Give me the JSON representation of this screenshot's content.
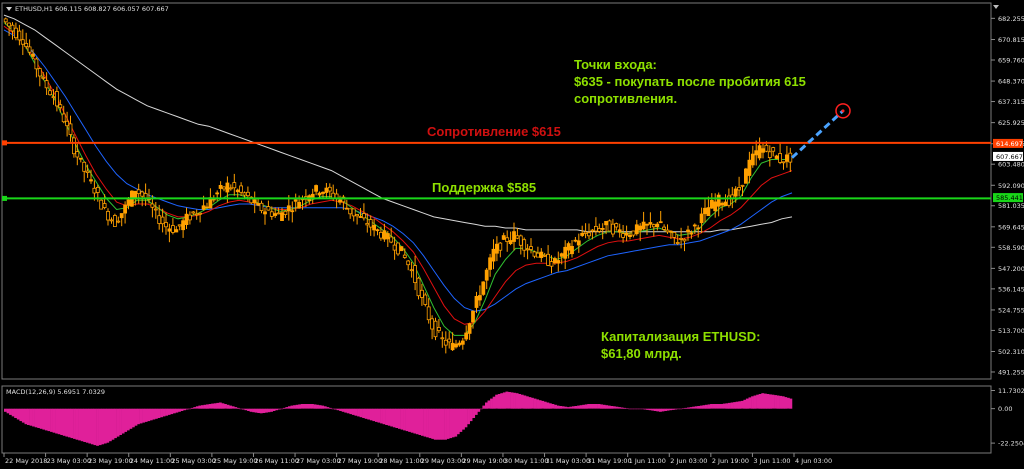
{
  "header": {
    "symbol_info": "ETHUSD,H1  606.115 608.827 606.057 607.667",
    "macd_info": "MACD(12,26,9) 5.6951 7.0329"
  },
  "colors": {
    "background": "#000000",
    "candle_up": "#ffa000",
    "candle_down": "#ffa000",
    "resistance": "#ff4000",
    "support": "#19d619",
    "ma_red": "#e01010",
    "ma_green": "#30c030",
    "ma_blue": "#1e64ff",
    "ma_white": "#d8d8d8",
    "macd": "#e0209a",
    "annotation_green": "#8ee000",
    "annotation_red": "#d01010",
    "arrow": "#4aa3ff",
    "target_circle": "#ff2020",
    "grid_text": "#e0e0e0"
  },
  "annotations": {
    "entry_line1": "Точки входа:",
    "entry_line2": "$635 - покупать после пробития 615",
    "entry_line3": "сопротивления.",
    "resistance_label": "Сопротивление $615",
    "support_label": "Поддержка $585",
    "cap_line1": "Капитализация ETHUSD:",
    "cap_line2": "$61,80 млрд."
  },
  "chart_data": [
    {
      "type": "candlestick",
      "symbol": "ETHUSD",
      "timeframe": "H1",
      "ylim": [
        488,
        690
      ],
      "yticks": [
        "682.255",
        "670.815",
        "659.760",
        "648.370",
        "637.315",
        "625.925",
        "614.535",
        "603.480",
        "592.090",
        "581.035",
        "569.645",
        "558.590",
        "547.200",
        "536.145",
        "524.755",
        "513.700",
        "502.310",
        "491.255"
      ],
      "current_price_label": "607.667",
      "resistance_label_value": "614.697",
      "support_label_value": "585.441",
      "resistance": 615,
      "support": 585,
      "target": 635,
      "xticks": [
        "22 May 2018",
        "23 May 03:00",
        "23 May 19:00",
        "24 May 11:00",
        "25 May 03:00",
        "25 May 19:00",
        "26 May 11:00",
        "27 May 03:00",
        "27 May 19:00",
        "28 May 11:00",
        "29 May 03:00",
        "29 May 19:00",
        "30 May 11:00",
        "31 May 03:00",
        "31 May 19:00",
        "1 Jun 11:00",
        "2 Jun 03:00",
        "2 Jun 19:00",
        "3 Jun 11:00",
        "4 Jun 03:00"
      ],
      "close_path": [
        682,
        676,
        671,
        660,
        648,
        640,
        628,
        612,
        600,
        590,
        578,
        572,
        580,
        590,
        585,
        576,
        570,
        568,
        574,
        578,
        582,
        588,
        592,
        589,
        585,
        580,
        578,
        576,
        580,
        584,
        588,
        590,
        588,
        584,
        578,
        574,
        570,
        566,
        562,
        556,
        546,
        530,
        516,
        508,
        505,
        510,
        524,
        540,
        556,
        562,
        565,
        560,
        556,
        552,
        550,
        556,
        562,
        566,
        568,
        570,
        568,
        566,
        568,
        570,
        572,
        566,
        562,
        566,
        572,
        580,
        584,
        584,
        590,
        604,
        612,
        610,
        606,
        607
      ],
      "ma_fast": [
        680,
        675,
        668,
        658,
        648,
        638,
        626,
        614,
        603,
        594,
        585,
        579,
        580,
        584,
        584,
        580,
        576,
        574,
        575,
        577,
        580,
        584,
        587,
        587,
        585,
        582,
        580,
        578,
        579,
        581,
        584,
        586,
        586,
        584,
        580,
        576,
        572,
        568,
        564,
        558,
        550,
        538,
        526,
        516,
        511,
        511,
        518,
        530,
        544,
        552,
        558,
        558,
        556,
        554,
        552,
        554,
        558,
        562,
        565,
        567,
        567,
        566,
        567,
        568,
        569,
        567,
        565,
        566,
        569,
        575,
        580,
        582,
        586,
        596,
        604,
        606,
        606,
        606
      ],
      "ma_mid": [
        678,
        674,
        668,
        660,
        651,
        641,
        630,
        619,
        608,
        598,
        590,
        583,
        581,
        582,
        582,
        580,
        577,
        575,
        575,
        576,
        578,
        581,
        583,
        584,
        583,
        582,
        580,
        579,
        579,
        580,
        582,
        583,
        584,
        583,
        581,
        578,
        575,
        571,
        567,
        562,
        556,
        547,
        537,
        527,
        520,
        517,
        518,
        524,
        532,
        540,
        546,
        549,
        550,
        550,
        550,
        551,
        553,
        556,
        559,
        561,
        562,
        562,
        563,
        564,
        565,
        564,
        563,
        564,
        566,
        569,
        573,
        576,
        580,
        586,
        592,
        596,
        598,
        600
      ],
      "ma_slow": [
        676,
        673,
        669,
        663,
        656,
        648,
        640,
        631,
        622,
        613,
        605,
        598,
        593,
        590,
        587,
        585,
        583,
        581,
        580,
        579,
        579,
        580,
        581,
        582,
        582,
        581,
        580,
        580,
        580,
        580,
        580,
        580,
        580,
        580,
        579,
        577,
        575,
        573,
        570,
        566,
        561,
        554,
        546,
        538,
        531,
        526,
        524,
        525,
        528,
        532,
        536,
        539,
        541,
        543,
        545,
        546,
        548,
        550,
        552,
        554,
        555,
        556,
        557,
        558,
        559,
        560,
        560,
        561,
        562,
        564,
        566,
        568,
        571,
        575,
        579,
        583,
        586,
        588
      ],
      "ma_200": [
        684,
        682,
        679,
        676,
        672,
        668,
        664,
        660,
        656,
        652,
        648,
        644,
        641,
        638,
        635,
        633,
        631,
        629,
        627,
        625,
        624,
        622,
        620,
        618,
        616,
        614,
        612,
        610,
        608,
        606,
        604,
        602,
        600,
        597,
        594,
        591,
        588,
        585,
        583,
        581,
        579,
        577,
        575,
        574,
        573,
        572,
        571,
        570,
        570,
        569,
        569,
        568,
        568,
        568,
        568,
        568,
        568,
        567,
        567,
        567,
        567,
        567,
        567,
        567,
        567,
        567,
        567,
        567,
        567,
        567,
        568,
        568,
        569,
        570,
        571,
        572,
        574,
        575
      ]
    },
    {
      "type": "histogram",
      "indicator": "MACD(12,26,9)",
      "main": 5.6951,
      "signal": 7.0329,
      "ylim": [
        -28,
        14
      ],
      "yticks": [
        "11.7302",
        "0.00",
        "-22.2504"
      ],
      "values": [
        -2,
        -6,
        -10,
        -12,
        -14,
        -16,
        -18,
        -20,
        -22,
        -24,
        -22,
        -18,
        -14,
        -10,
        -8,
        -6,
        -4,
        -2,
        0,
        2,
        3,
        4,
        2,
        0,
        -2,
        -3,
        -2,
        0,
        2,
        3,
        3,
        2,
        0,
        -2,
        -4,
        -6,
        -8,
        -10,
        -12,
        -14,
        -16,
        -18,
        -20,
        -20,
        -18,
        -12,
        -4,
        4,
        9,
        11,
        10,
        8,
        6,
        4,
        2,
        1,
        2,
        3,
        3,
        2,
        1,
        0,
        0,
        -1,
        -2,
        -1,
        0,
        1,
        2,
        3,
        3,
        4,
        5,
        8,
        10,
        9,
        8,
        6
      ]
    }
  ]
}
